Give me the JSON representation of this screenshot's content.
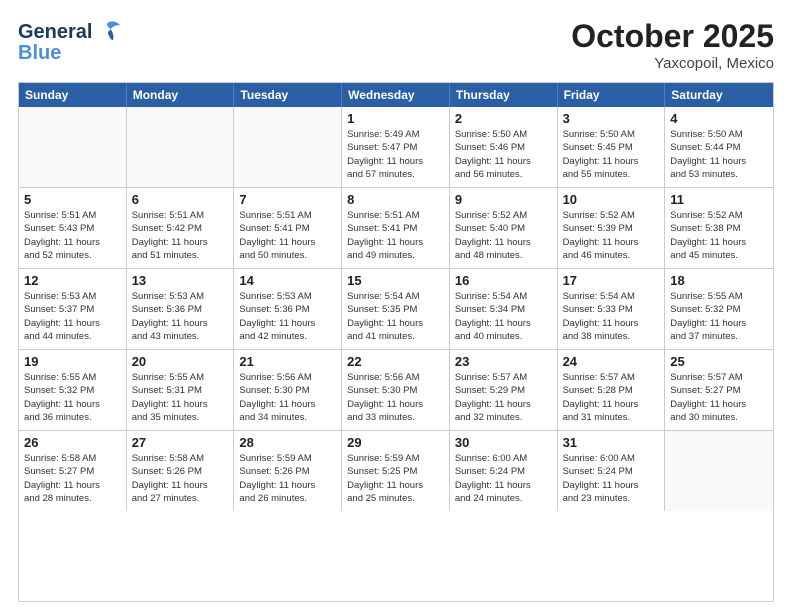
{
  "header": {
    "logo_line1": "General",
    "logo_line2": "Blue",
    "month": "October 2025",
    "location": "Yaxcopoil, Mexico"
  },
  "days_of_week": [
    "Sunday",
    "Monday",
    "Tuesday",
    "Wednesday",
    "Thursday",
    "Friday",
    "Saturday"
  ],
  "weeks": [
    [
      {
        "day": "",
        "info": "",
        "empty": true
      },
      {
        "day": "",
        "info": "",
        "empty": true
      },
      {
        "day": "",
        "info": "",
        "empty": true
      },
      {
        "day": "1",
        "info": "Sunrise: 5:49 AM\nSunset: 5:47 PM\nDaylight: 11 hours\nand 57 minutes."
      },
      {
        "day": "2",
        "info": "Sunrise: 5:50 AM\nSunset: 5:46 PM\nDaylight: 11 hours\nand 56 minutes."
      },
      {
        "day": "3",
        "info": "Sunrise: 5:50 AM\nSunset: 5:45 PM\nDaylight: 11 hours\nand 55 minutes."
      },
      {
        "day": "4",
        "info": "Sunrise: 5:50 AM\nSunset: 5:44 PM\nDaylight: 11 hours\nand 53 minutes."
      }
    ],
    [
      {
        "day": "5",
        "info": "Sunrise: 5:51 AM\nSunset: 5:43 PM\nDaylight: 11 hours\nand 52 minutes."
      },
      {
        "day": "6",
        "info": "Sunrise: 5:51 AM\nSunset: 5:42 PM\nDaylight: 11 hours\nand 51 minutes."
      },
      {
        "day": "7",
        "info": "Sunrise: 5:51 AM\nSunset: 5:41 PM\nDaylight: 11 hours\nand 50 minutes."
      },
      {
        "day": "8",
        "info": "Sunrise: 5:51 AM\nSunset: 5:41 PM\nDaylight: 11 hours\nand 49 minutes."
      },
      {
        "day": "9",
        "info": "Sunrise: 5:52 AM\nSunset: 5:40 PM\nDaylight: 11 hours\nand 48 minutes."
      },
      {
        "day": "10",
        "info": "Sunrise: 5:52 AM\nSunset: 5:39 PM\nDaylight: 11 hours\nand 46 minutes."
      },
      {
        "day": "11",
        "info": "Sunrise: 5:52 AM\nSunset: 5:38 PM\nDaylight: 11 hours\nand 45 minutes."
      }
    ],
    [
      {
        "day": "12",
        "info": "Sunrise: 5:53 AM\nSunset: 5:37 PM\nDaylight: 11 hours\nand 44 minutes."
      },
      {
        "day": "13",
        "info": "Sunrise: 5:53 AM\nSunset: 5:36 PM\nDaylight: 11 hours\nand 43 minutes."
      },
      {
        "day": "14",
        "info": "Sunrise: 5:53 AM\nSunset: 5:36 PM\nDaylight: 11 hours\nand 42 minutes."
      },
      {
        "day": "15",
        "info": "Sunrise: 5:54 AM\nSunset: 5:35 PM\nDaylight: 11 hours\nand 41 minutes."
      },
      {
        "day": "16",
        "info": "Sunrise: 5:54 AM\nSunset: 5:34 PM\nDaylight: 11 hours\nand 40 minutes."
      },
      {
        "day": "17",
        "info": "Sunrise: 5:54 AM\nSunset: 5:33 PM\nDaylight: 11 hours\nand 38 minutes."
      },
      {
        "day": "18",
        "info": "Sunrise: 5:55 AM\nSunset: 5:32 PM\nDaylight: 11 hours\nand 37 minutes."
      }
    ],
    [
      {
        "day": "19",
        "info": "Sunrise: 5:55 AM\nSunset: 5:32 PM\nDaylight: 11 hours\nand 36 minutes."
      },
      {
        "day": "20",
        "info": "Sunrise: 5:55 AM\nSunset: 5:31 PM\nDaylight: 11 hours\nand 35 minutes."
      },
      {
        "day": "21",
        "info": "Sunrise: 5:56 AM\nSunset: 5:30 PM\nDaylight: 11 hours\nand 34 minutes."
      },
      {
        "day": "22",
        "info": "Sunrise: 5:56 AM\nSunset: 5:30 PM\nDaylight: 11 hours\nand 33 minutes."
      },
      {
        "day": "23",
        "info": "Sunrise: 5:57 AM\nSunset: 5:29 PM\nDaylight: 11 hours\nand 32 minutes."
      },
      {
        "day": "24",
        "info": "Sunrise: 5:57 AM\nSunset: 5:28 PM\nDaylight: 11 hours\nand 31 minutes."
      },
      {
        "day": "25",
        "info": "Sunrise: 5:57 AM\nSunset: 5:27 PM\nDaylight: 11 hours\nand 30 minutes."
      }
    ],
    [
      {
        "day": "26",
        "info": "Sunrise: 5:58 AM\nSunset: 5:27 PM\nDaylight: 11 hours\nand 28 minutes."
      },
      {
        "day": "27",
        "info": "Sunrise: 5:58 AM\nSunset: 5:26 PM\nDaylight: 11 hours\nand 27 minutes."
      },
      {
        "day": "28",
        "info": "Sunrise: 5:59 AM\nSunset: 5:26 PM\nDaylight: 11 hours\nand 26 minutes."
      },
      {
        "day": "29",
        "info": "Sunrise: 5:59 AM\nSunset: 5:25 PM\nDaylight: 11 hours\nand 25 minutes."
      },
      {
        "day": "30",
        "info": "Sunrise: 6:00 AM\nSunset: 5:24 PM\nDaylight: 11 hours\nand 24 minutes."
      },
      {
        "day": "31",
        "info": "Sunrise: 6:00 AM\nSunset: 5:24 PM\nDaylight: 11 hours\nand 23 minutes."
      },
      {
        "day": "",
        "info": "",
        "empty": true
      }
    ]
  ]
}
